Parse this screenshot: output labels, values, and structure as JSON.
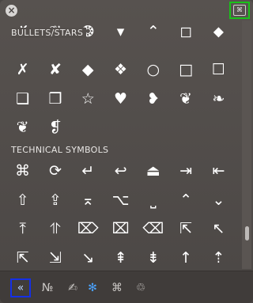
{
  "top": {
    "close_icon": "close-icon",
    "keyboard_icon": "⌘"
  },
  "sections": [
    {
      "title": "BULLETS/STARS",
      "symbols": [
        "✗",
        "✘",
        "◆",
        "❖",
        "○",
        "□",
        "☐",
        "❑",
        "❒",
        "☆",
        "♥",
        "❥",
        "❦",
        "❧",
        "❦",
        "❡"
      ],
      "partial_row": [
        "✗",
        "❦",
        "❂",
        "▾",
        "⌃",
        "◻",
        "⬥"
      ]
    },
    {
      "title": "TECHNICAL SYMBOLS",
      "symbols": [
        "⌘",
        "⟳",
        "↵",
        "↩",
        "⏏",
        "⇥",
        "⇤",
        "⇧",
        "⇪",
        "⌅",
        "⌥",
        "⎵",
        "⌃",
        "⌄",
        "⤒",
        "⥣",
        "⌦",
        "⌧",
        "⌫",
        "⇱",
        "↖",
        "⇱",
        "⇲",
        "↘",
        "⇞",
        "⇟",
        "↑",
        "⇡"
      ]
    }
  ],
  "bottom_tabs": [
    {
      "name": "collapse",
      "label": "«"
    },
    {
      "name": "number-symbols",
      "label": "№"
    },
    {
      "name": "pen",
      "label": "✍"
    },
    {
      "name": "asterisk",
      "label": "✻"
    },
    {
      "name": "command",
      "label": "⌘"
    },
    {
      "name": "recycle",
      "label": "♲"
    }
  ]
}
